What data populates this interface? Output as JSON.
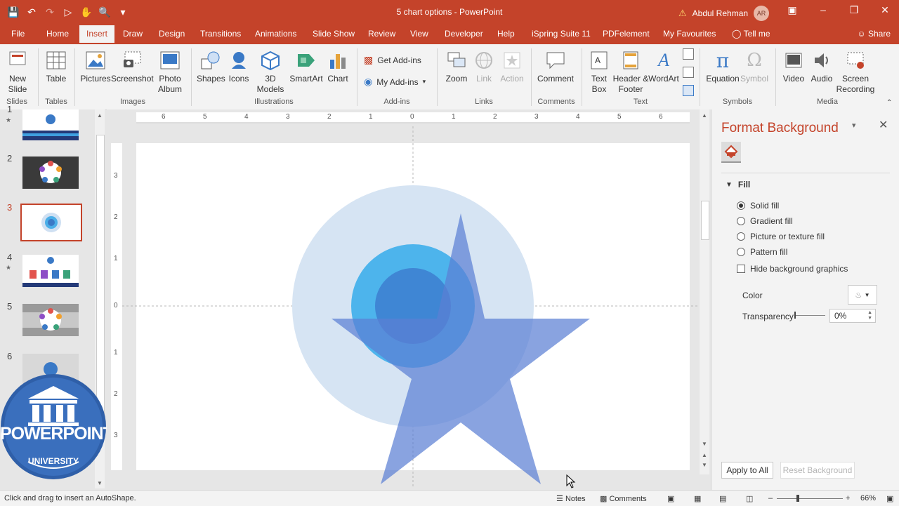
{
  "window": {
    "title": "5 chart options - PowerPoint",
    "user_name": "Abdul Rehman",
    "user_initials": "AR",
    "accent_color": "#c4432a"
  },
  "tabs": [
    "File",
    "Home",
    "Insert",
    "Draw",
    "Design",
    "Transitions",
    "Animations",
    "Slide Show",
    "Review",
    "View",
    "Developer",
    "Help",
    "iSpring Suite 11",
    "PDFelement",
    "My Favourites",
    "Tell me"
  ],
  "active_tab": "Insert",
  "share_label": "Share",
  "ribbon": {
    "new_slide": "New Slide",
    "table": "Table",
    "pictures": "Pictures",
    "screenshot": "Screenshot",
    "photo_album": "Photo Album",
    "shapes": "Shapes",
    "icons": "Icons",
    "models_3d": "3D Models",
    "smartart": "SmartArt",
    "chart": "Chart",
    "get_addins": "Get Add-ins",
    "my_addins": "My Add-ins",
    "zoom": "Zoom",
    "link": "Link",
    "action": "Action",
    "comment": "Comment",
    "text_box": "Text Box",
    "header_footer": "Header & Footer",
    "wordart": "WordArt",
    "equation": "Equation",
    "symbol": "Symbol",
    "video": "Video",
    "audio": "Audio",
    "screen_recording": "Screen Recording",
    "groups": {
      "slides": "Slides",
      "tables": "Tables",
      "images": "Images",
      "illustrations": "Illustrations",
      "addins": "Add-ins",
      "links": "Links",
      "comments": "Comments",
      "text": "Text",
      "symbols": "Symbols",
      "media": "Media"
    }
  },
  "thumbnails": {
    "numbers": [
      "1",
      "2",
      "3",
      "4",
      "5",
      "6"
    ],
    "selected": "3"
  },
  "watermark": {
    "line1": "POWERPOINT",
    "line2": "UNIVERSITY"
  },
  "rulers": {
    "horizontal": [
      "6",
      "5",
      "4",
      "3",
      "2",
      "1",
      "0",
      "1",
      "2",
      "3",
      "4",
      "5",
      "6"
    ],
    "vertical": [
      "3",
      "2",
      "1",
      "0",
      "1",
      "2",
      "3"
    ]
  },
  "format_background": {
    "title": "Format Background",
    "section": "Fill",
    "options": [
      "Solid fill",
      "Gradient fill",
      "Picture or texture fill",
      "Pattern fill"
    ],
    "selected_option": "Solid fill",
    "hide_graphics": "Hide background graphics",
    "color_label": "Color",
    "transparency_label": "Transparency",
    "transparency_value": "0%",
    "apply_all": "Apply to All",
    "reset": "Reset Background"
  },
  "status": {
    "hint": "Click and drag to insert an AutoShape.",
    "notes": "Notes",
    "comments": "Comments",
    "zoom": "66%"
  }
}
